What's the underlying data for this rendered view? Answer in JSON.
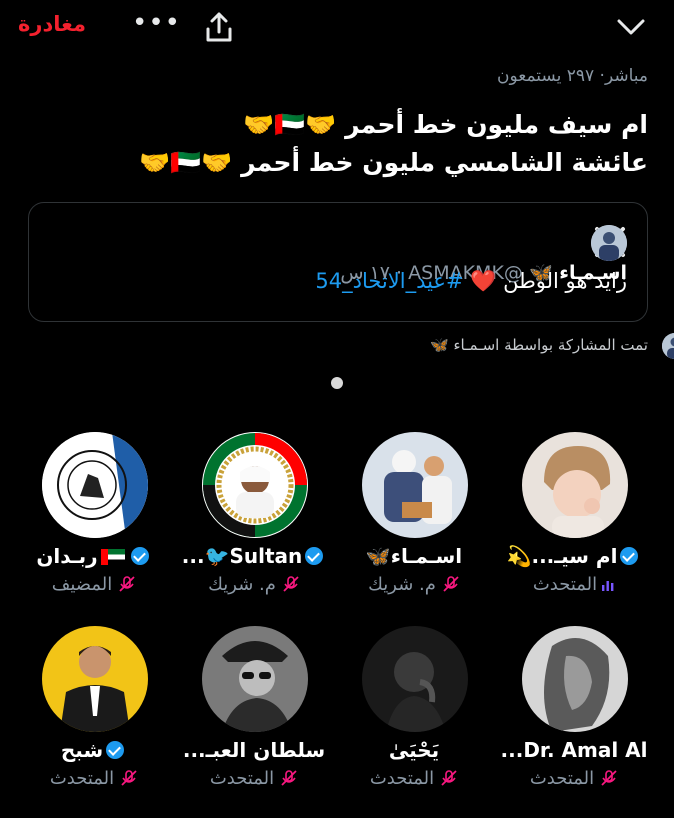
{
  "header": {
    "leave_label": "مغادرة",
    "more_icon": "more-horizontal-icon",
    "share_icon": "share-icon",
    "collapse_icon": "chevron-down-icon"
  },
  "space": {
    "live_label": "مباشر",
    "listeners": "٢٩٧ يستمعون",
    "title_line1": "ام سيف مليون خط أحمر 🤝🇦🇪🤝",
    "title_line2": "عائشة الشامسي مليون خط أحمر 🤝🇦🇪🤝"
  },
  "pinned_post": {
    "author_name": "اسـمـاء 🦋",
    "handle": "@ASMAKMK",
    "time": "١٧ س",
    "text_before": "زايد هو الوطن",
    "heart": "❤️",
    "hashtag": "#عيد_الاتحاد_54",
    "logo": "x-logo-icon"
  },
  "shared_by": "تمت المشاركة بواسطة اسـمـاء 🦋",
  "participants": [
    {
      "name": "ربـدان",
      "role": "المضيف"
    },
    {
      "name": "Sultan🐦...",
      "role": "م. شريك"
    },
    {
      "name": "اسـمـاء🦋",
      "role": "م. شريك"
    },
    {
      "name": "ام سيـ...💫",
      "role": "المتحدث"
    },
    {
      "name": "شبح",
      "role": "المتحدث"
    },
    {
      "name": "سلطان العبـ...",
      "role": "المتحدث"
    },
    {
      "name": "يَحْيَىٰ",
      "role": "المتحدث"
    },
    {
      "name": "Dr. Amal Al...",
      "role": "المتحدث"
    }
  ],
  "colors": {
    "accent": "#1d9bf0",
    "leave": "#f4212e",
    "muted_mic": "#f91880",
    "speaking": "#7856ff"
  }
}
